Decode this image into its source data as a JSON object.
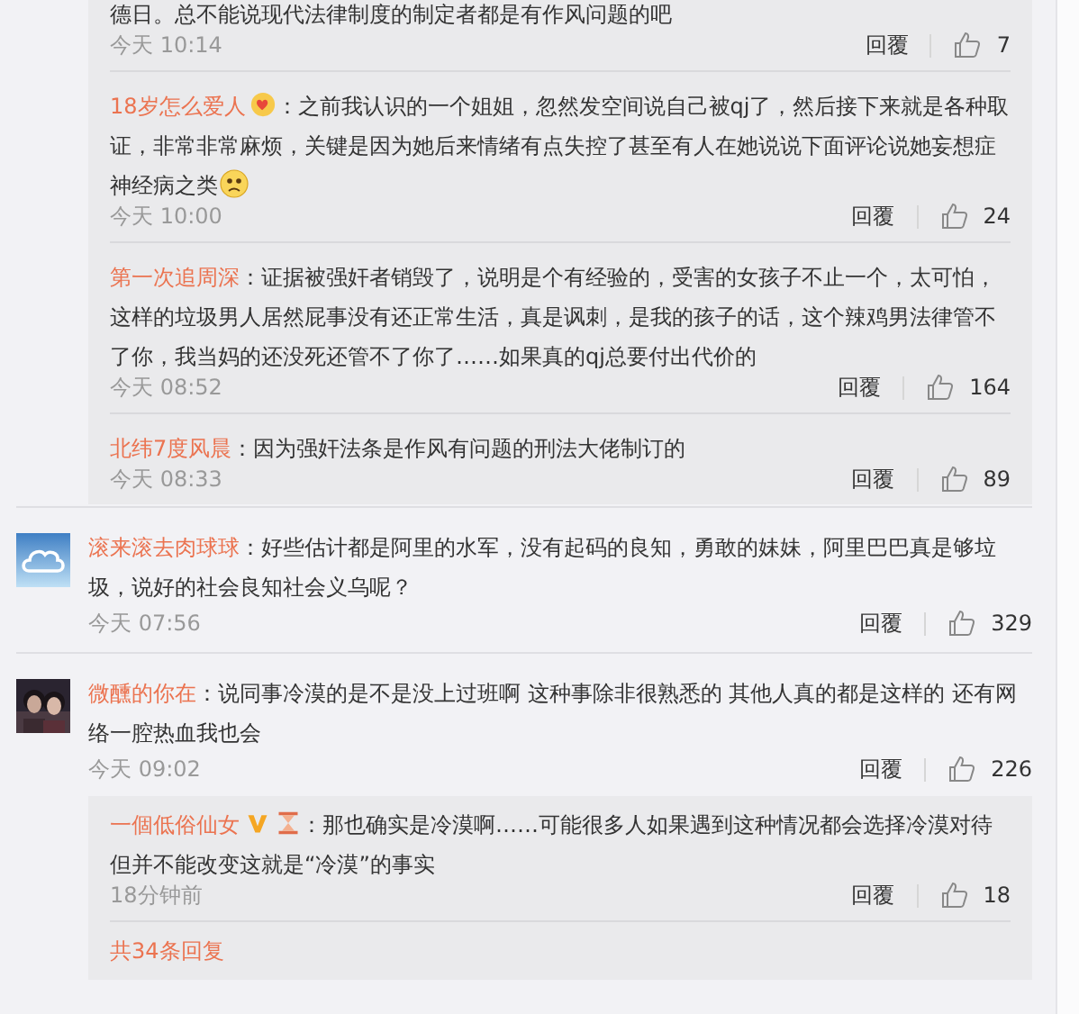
{
  "top_reply_box": {
    "replies": [
      {
        "text": "德日。总不能说现代法律制度的制定者都是有作风问题的吧",
        "time": "今天 10:14",
        "reply_label": "回覆",
        "likes": "7"
      },
      {
        "user": "18岁怎么爱人",
        "badges": [
          {
            "kind": "heart"
          }
        ],
        "text": "：之前我认识的一个姐姐，忽然发空间说自己被qj了，然后接下来就是各种取证，非常非常麻烦，关键是因为她后来情绪有点失控了甚至有人在她说说下面评论说她妄想症神经病之类",
        "end_emoji": {
          "kind": "sad"
        },
        "time": "今天 10:00",
        "reply_label": "回覆",
        "likes": "24"
      },
      {
        "user": "第一次追周深",
        "text": "：证据被强奸者销毁了，说明是个有经验的，受害的女孩子不止一个，太可怕，这样的垃圾男人居然屁事没有还正常生活，真是讽刺，是我的孩子的话，这个辣鸡男法律管不了你，我当妈的还没死还管不了你了……如果真的qj总要付出代价的",
        "time": "今天 08:52",
        "reply_label": "回覆",
        "likes": "164"
      },
      {
        "user": "北纬7度风晨",
        "text": "：因为强奸法条是作风有问题的刑法大佬制订的",
        "time": "今天 08:33",
        "reply_label": "回覆",
        "likes": "89"
      }
    ]
  },
  "comments": [
    {
      "avatar": {
        "kind": "cloud"
      },
      "user": "滚来滚去肉球球",
      "text": "：好些估计都是阿里的水军，没有起码的良知，勇敢的妹妹，阿里巴巴真是够垃圾，说好的社会良知社会义乌呢？",
      "time": "今天 07:56",
      "reply_label": "回覆",
      "likes": "329"
    },
    {
      "user": "微醺的你在",
      "text": "：说同事冷漠的是不是没上过班啊 这种事除非很熟悉的 其他人真的都是这样的 还有网络一腔热血我也会",
      "time": "今天 09:02",
      "reply_label": "回覆",
      "likes": "226",
      "reply_box": {
        "replies": [
          {
            "user": "一個低俗仙女",
            "badges": [
              {
                "kind": "vip"
              },
              {
                "kind": "hourglass"
              }
            ],
            "text": "：那也确实是冷漠啊……可能很多人如果遇到这种情况都会选择冷漠对待但并不能改变这就是“冷漠”的事实",
            "time": "18分钟前",
            "reply_label": "回覆",
            "likes": "18"
          }
        ],
        "more_replies": "共34条回复"
      }
    }
  ]
}
